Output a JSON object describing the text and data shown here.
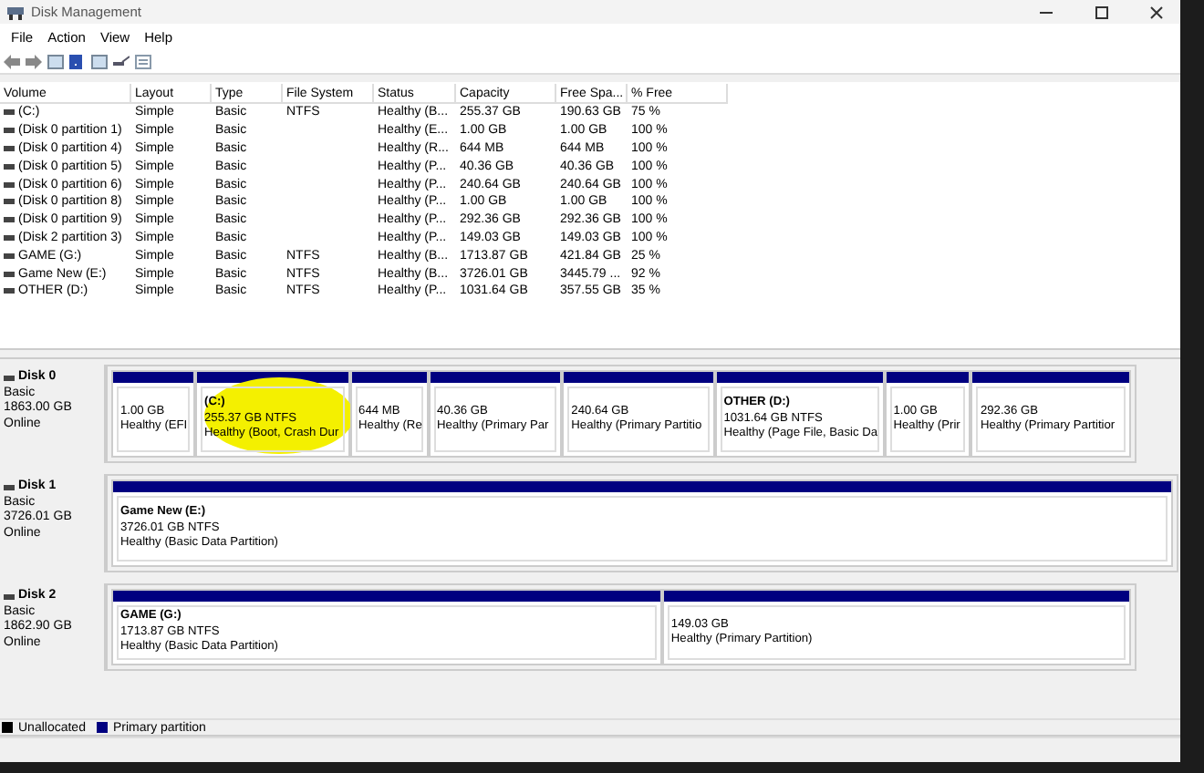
{
  "window": {
    "title": "Disk Management"
  },
  "menu": [
    "File",
    "Action",
    "View",
    "Help"
  ],
  "table": {
    "columns": [
      "Volume",
      "Layout",
      "Type",
      "File System",
      "Status",
      "Capacity",
      "Free Spa...",
      "% Free"
    ],
    "rows": [
      [
        "(C:)",
        "Simple",
        "Basic",
        "NTFS",
        "Healthy (B...",
        "255.37 GB",
        "190.63 GB",
        "75 %"
      ],
      [
        "(Disk 0 partition 1)",
        "Simple",
        "Basic",
        "",
        "Healthy (E...",
        "1.00 GB",
        "1.00 GB",
        "100 %"
      ],
      [
        "(Disk 0 partition 4)",
        "Simple",
        "Basic",
        "",
        "Healthy (R...",
        "644 MB",
        "644 MB",
        "100 %"
      ],
      [
        "(Disk 0 partition 5)",
        "Simple",
        "Basic",
        "",
        "Healthy (P...",
        "40.36 GB",
        "40.36 GB",
        "100 %"
      ],
      [
        "(Disk 0 partition 6)",
        "Simple",
        "Basic",
        "",
        "Healthy (P...",
        "240.64 GB",
        "240.64 GB",
        "100 %"
      ],
      [
        "(Disk 0 partition 8)",
        "Simple",
        "Basic",
        "",
        "Healthy (P...",
        "1.00 GB",
        "1.00 GB",
        "100 %"
      ],
      [
        "(Disk 0 partition 9)",
        "Simple",
        "Basic",
        "",
        "Healthy (P...",
        "292.36 GB",
        "292.36 GB",
        "100 %"
      ],
      [
        "(Disk 2 partition 3)",
        "Simple",
        "Basic",
        "",
        "Healthy (P...",
        "149.03 GB",
        "149.03 GB",
        "100 %"
      ],
      [
        "GAME (G:)",
        "Simple",
        "Basic",
        "NTFS",
        "Healthy (B...",
        "1713.87 GB",
        "421.84 GB",
        "25 %"
      ],
      [
        "Game New (E:)",
        "Simple",
        "Basic",
        "NTFS",
        "Healthy (B...",
        "3726.01 GB",
        "3445.79 ...",
        "92 %"
      ],
      [
        "OTHER (D:)",
        "Simple",
        "Basic",
        "NTFS",
        "Healthy (P...",
        "1031.64 GB",
        "357.55 GB",
        "35 %"
      ]
    ]
  },
  "disks": [
    {
      "name": "Disk 0",
      "type": "Basic",
      "size": "1863.00 GB",
      "status": "Online",
      "partitions": [
        {
          "size": "1.00 GB",
          "status": "Healthy (EFI"
        },
        {
          "name": "(C:)",
          "size": "255.37 GB NTFS",
          "status": "Healthy (Boot, Crash Dur",
          "highlighted": true
        },
        {
          "size": "644 MB",
          "status": "Healthy (Re"
        },
        {
          "size": "40.36 GB",
          "status": "Healthy (Primary Par"
        },
        {
          "size": "240.64 GB",
          "status": "Healthy (Primary Partitio"
        },
        {
          "name": "OTHER  (D:)",
          "size": "1031.64 GB NTFS",
          "status": "Healthy (Page File, Basic Da"
        },
        {
          "size": "1.00 GB",
          "status": "Healthy (Prir"
        },
        {
          "size": "292.36 GB",
          "status": "Healthy (Primary Partitior"
        }
      ]
    },
    {
      "name": "Disk 1",
      "type": "Basic",
      "size": "3726.01 GB",
      "status": "Online",
      "partitions": [
        {
          "name": "Game New  (E:)",
          "size": "3726.01 GB NTFS",
          "status": "Healthy (Basic Data Partition)"
        }
      ]
    },
    {
      "name": "Disk 2",
      "type": "Basic",
      "size": "1862.90 GB",
      "status": "Online",
      "partitions": [
        {
          "name": "GAME  (G:)",
          "size": "1713.87 GB NTFS",
          "status": "Healthy (Basic Data Partition)"
        },
        {
          "size": "149.03 GB",
          "status": "Healthy (Primary Partition)"
        }
      ]
    }
  ],
  "legend": [
    {
      "label": "Unallocated",
      "color": "#000000"
    },
    {
      "label": "Primary partition",
      "color": "#000080"
    }
  ]
}
